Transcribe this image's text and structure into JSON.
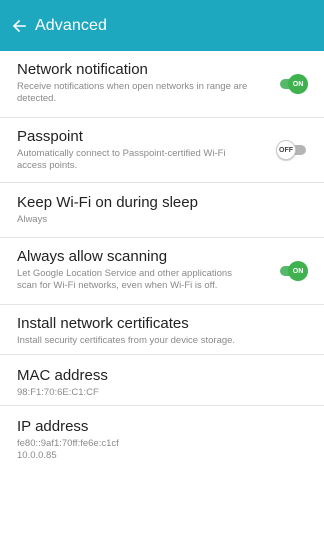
{
  "header": {
    "back_icon": "arrow-left-icon",
    "title": "Advanced"
  },
  "colors": {
    "appbar": "#1ea8c0",
    "toggle_on": "#3fb24f",
    "toggle_off_track": "#b5b5b5"
  },
  "settings": [
    {
      "title": "Network notification",
      "subtitle": "Receive notifications when open networks in range are detected.",
      "toggle": {
        "state": "on",
        "label": "ON"
      }
    },
    {
      "title": "Passpoint",
      "subtitle": "Automatically connect to Passpoint-certified Wi-Fi access points.",
      "toggle": {
        "state": "off",
        "label": "OFF"
      }
    },
    {
      "title": "Keep Wi-Fi on during sleep",
      "subtitle": "Always"
    },
    {
      "title": "Always allow scanning",
      "subtitle": "Let Google Location Service and other applications scan for Wi-Fi networks, even when Wi-Fi is off.",
      "toggle": {
        "state": "on",
        "label": "ON"
      }
    },
    {
      "title": "Install network certificates",
      "subtitle": "Install security certificates from your device storage."
    },
    {
      "title": "MAC address",
      "subtitle": "98:F1:70:6E:C1:CF"
    },
    {
      "title": "IP address",
      "subtitle": "fe80::9af1:70ff:fe6e:c1cf",
      "subtitle2": "10.0.0.85"
    }
  ]
}
